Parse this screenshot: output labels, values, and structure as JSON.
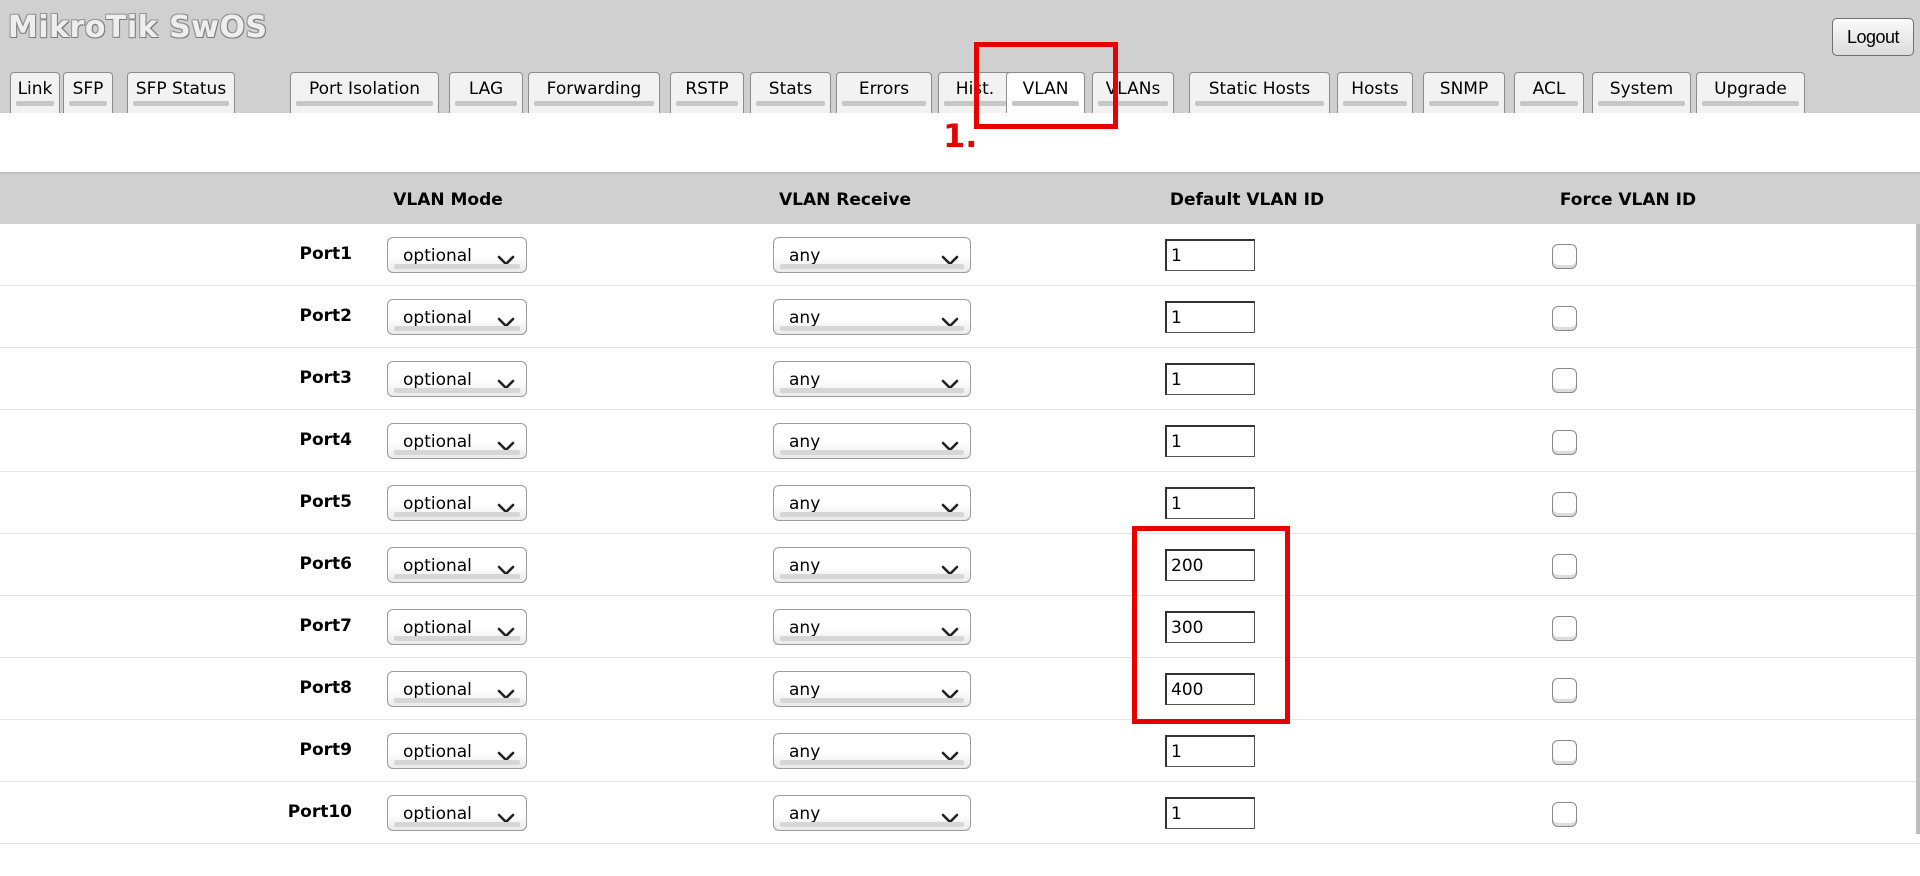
{
  "header": {
    "brand": "MikroTik SwOS",
    "logout_label": "Logout"
  },
  "tabs": [
    {
      "label": "Link"
    },
    {
      "label": "SFP"
    },
    {
      "label": "SFP Status"
    },
    {
      "label": "Port Isolation"
    },
    {
      "label": "LAG"
    },
    {
      "label": "Forwarding"
    },
    {
      "label": "RSTP"
    },
    {
      "label": "Stats"
    },
    {
      "label": "Errors"
    },
    {
      "label": "Hist."
    },
    {
      "label": "VLAN",
      "active": true
    },
    {
      "label": "VLANs"
    },
    {
      "label": "Static Hosts"
    },
    {
      "label": "Hosts"
    },
    {
      "label": "SNMP"
    },
    {
      "label": "ACL"
    },
    {
      "label": "System"
    },
    {
      "label": "Upgrade"
    }
  ],
  "annotations": {
    "step1_label": "1.",
    "highlight_color": "#e60000"
  },
  "table": {
    "columns": {
      "vlan_mode": "VLAN Mode",
      "vlan_receive": "VLAN Receive",
      "default_vlan_id": "Default VLAN ID",
      "force_vlan_id": "Force VLAN ID"
    },
    "rows": [
      {
        "port": "Port1",
        "vlan_mode": "optional",
        "vlan_receive": "any",
        "default_vlan_id": "1",
        "force_vlan_id": false
      },
      {
        "port": "Port2",
        "vlan_mode": "optional",
        "vlan_receive": "any",
        "default_vlan_id": "1",
        "force_vlan_id": false
      },
      {
        "port": "Port3",
        "vlan_mode": "optional",
        "vlan_receive": "any",
        "default_vlan_id": "1",
        "force_vlan_id": false
      },
      {
        "port": "Port4",
        "vlan_mode": "optional",
        "vlan_receive": "any",
        "default_vlan_id": "1",
        "force_vlan_id": false
      },
      {
        "port": "Port5",
        "vlan_mode": "optional",
        "vlan_receive": "any",
        "default_vlan_id": "1",
        "force_vlan_id": false
      },
      {
        "port": "Port6",
        "vlan_mode": "optional",
        "vlan_receive": "any",
        "default_vlan_id": "200",
        "force_vlan_id": false
      },
      {
        "port": "Port7",
        "vlan_mode": "optional",
        "vlan_receive": "any",
        "default_vlan_id": "300",
        "force_vlan_id": false
      },
      {
        "port": "Port8",
        "vlan_mode": "optional",
        "vlan_receive": "any",
        "default_vlan_id": "400",
        "force_vlan_id": false
      },
      {
        "port": "Port9",
        "vlan_mode": "optional",
        "vlan_receive": "any",
        "default_vlan_id": "1",
        "force_vlan_id": false
      },
      {
        "port": "Port10",
        "vlan_mode": "optional",
        "vlan_receive": "any",
        "default_vlan_id": "1",
        "force_vlan_id": false
      }
    ]
  }
}
